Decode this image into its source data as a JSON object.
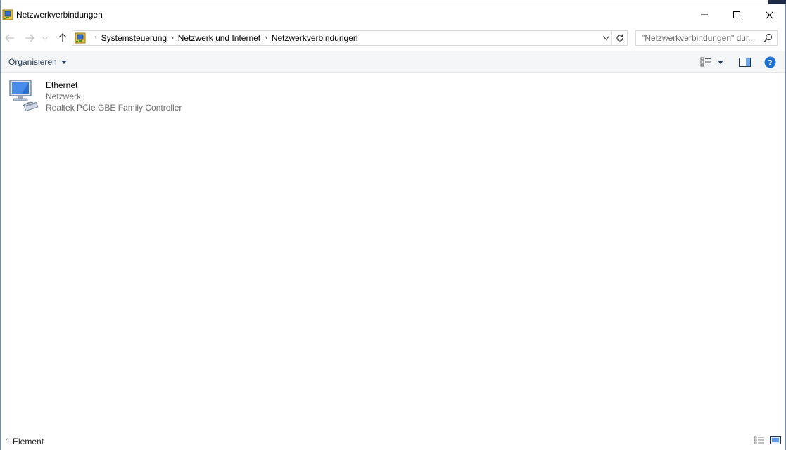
{
  "window": {
    "title": "Netzwerkverbindungen",
    "minimize_icon": "minimize-icon",
    "maximize_icon": "maximize-icon",
    "close_icon": "close-icon"
  },
  "navigation": {
    "back_icon": "arrow-left-icon",
    "forward_icon": "arrow-right-icon",
    "recent_icon": "chevron-down-icon",
    "up_icon": "arrow-up-icon"
  },
  "address": {
    "crumbs": [
      "Systemsteuerung",
      "Netzwerk und Internet",
      "Netzwerkverbindungen"
    ],
    "separator": "›",
    "refresh_icon": "refresh-icon"
  },
  "search": {
    "placeholder": "\"Netzwerkverbindungen\" dur..."
  },
  "commandbar": {
    "organize_label": "Organisieren"
  },
  "items": [
    {
      "name": "Ethernet",
      "network": "Netzwerk",
      "device": "Realtek PCIe GBE Family Controller",
      "icon": "network-adapter-icon"
    }
  ],
  "status": {
    "count_text": "1 Element"
  },
  "colors": {
    "accent": "#1e395b",
    "help": "#1a6fd0",
    "secondary_text": "#6d6d6d"
  }
}
